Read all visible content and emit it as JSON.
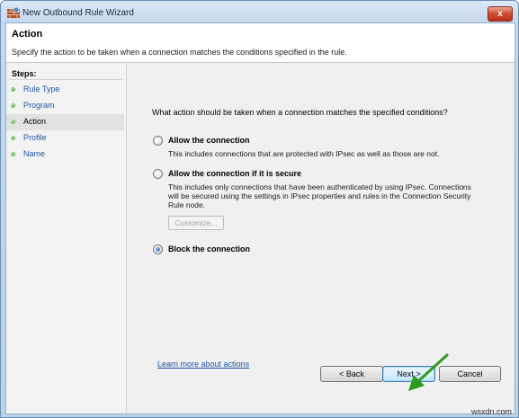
{
  "window": {
    "title": "New Outbound Rule Wizard",
    "close_label": "x"
  },
  "header": {
    "title": "Action",
    "description": "Specify the action to be taken when a connection matches the conditions specified in the rule."
  },
  "sidebar": {
    "heading": "Steps:",
    "items": [
      {
        "label": "Rule Type",
        "active": false
      },
      {
        "label": "Program",
        "active": false
      },
      {
        "label": "Action",
        "active": true
      },
      {
        "label": "Profile",
        "active": false
      },
      {
        "label": "Name",
        "active": false
      }
    ]
  },
  "main": {
    "question": "What action should be taken when a connection matches the specified conditions?",
    "options": [
      {
        "label": "Allow the connection",
        "description": "This includes connections that are protected with IPsec as well as those are not.",
        "selected": false
      },
      {
        "label": "Allow the connection if it is secure",
        "description": "This includes only connections that have been authenticated by using IPsec.  Connections will be secured using the settings in IPsec properties and rules in the Connection Security Rule node.",
        "selected": false
      },
      {
        "label": "Block the connection",
        "description": "",
        "selected": true
      }
    ],
    "customize_label": "Customize...",
    "learn_more_label": "Learn more about actions"
  },
  "buttons": {
    "back": "< Back",
    "next": "Next >",
    "cancel": "Cancel"
  },
  "watermark": "wsxdn.com",
  "colors": {
    "link": "#1f55a8",
    "arrow": "#2f9a1f",
    "step_dot": "#3d9a2a"
  }
}
